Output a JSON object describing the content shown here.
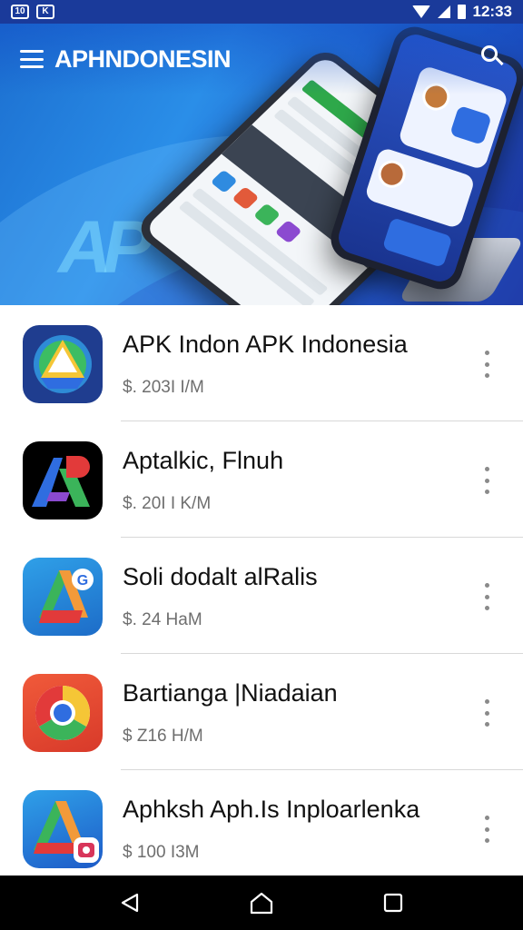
{
  "status_bar": {
    "time": "12:33",
    "left_icons": [
      "status-app-icon",
      "status-notification-icon"
    ]
  },
  "header": {
    "title": "APHNDONESIN",
    "menu_icon": "hamburger-menu-icon",
    "search_icon": "search-icon"
  },
  "banner": {
    "logo_text": "AP"
  },
  "apps": [
    {
      "name": "APK Indon APK Indonesia",
      "meta": "$. 203I I/M",
      "icon": "google-drive-style-icon"
    },
    {
      "name": "Aptalkic, Flnuh",
      "meta": "$. 20I I K/M",
      "icon": "colorful-ap-logo-icon"
    },
    {
      "name": "Soli dodalt alRalis",
      "meta": "$. 24 HaM",
      "icon": "drive-g-badge-icon"
    },
    {
      "name": "Bartianga |Niadaian",
      "meta": "$ Z16 H/M",
      "icon": "chrome-style-icon"
    },
    {
      "name": "Aphksh Aph.Is Inploarlenka",
      "meta": "$ 100 I3M",
      "icon": "drive-camera-badge-icon"
    }
  ],
  "colors": {
    "status_bar": "#1a3a9a",
    "banner_start": "#1c6fd0",
    "banner_end": "#1d2f9a",
    "divider": "#d8d8d8",
    "nav_bar": "#000000"
  },
  "nav_bar": {
    "back_icon": "back-triangle-icon",
    "home_icon": "home-icon",
    "recents_icon": "recents-square-icon"
  }
}
